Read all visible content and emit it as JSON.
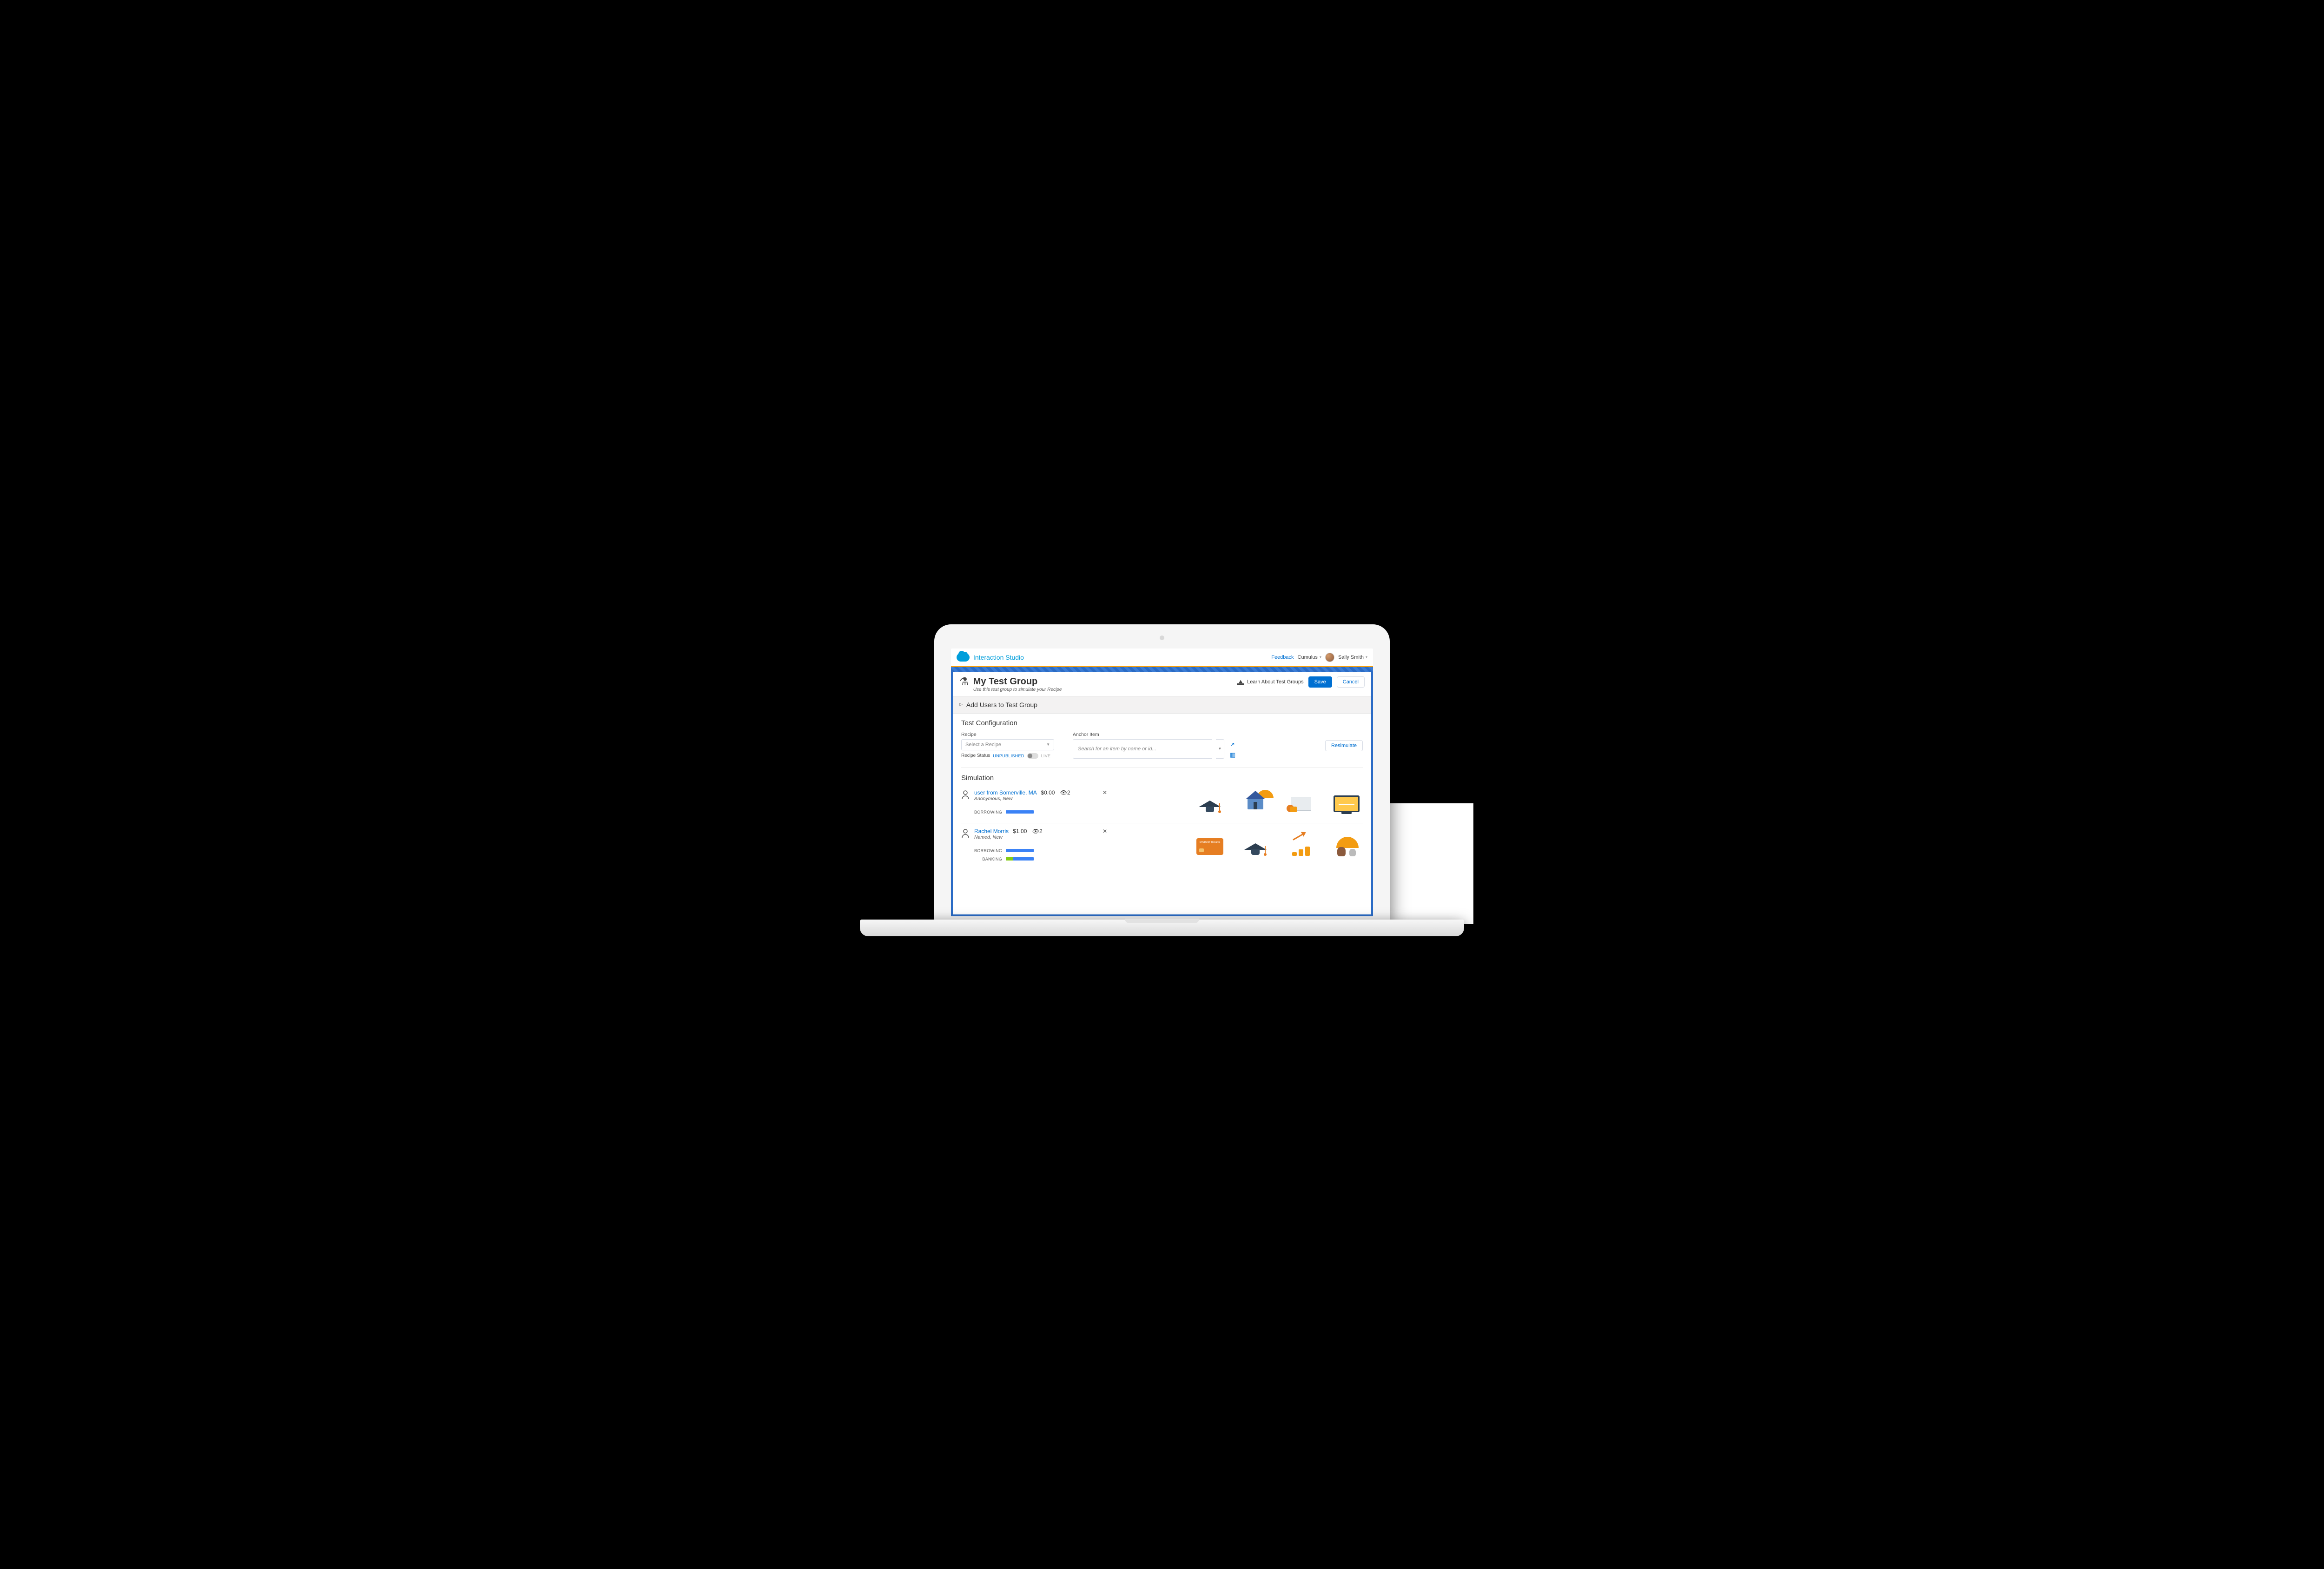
{
  "topbar": {
    "app_title": "Interaction Studio",
    "feedback_label": "Feedback",
    "org_name": "Cumulus",
    "user_name": "Sally Smith"
  },
  "page": {
    "title": "My Test Group",
    "subtitle": "Use this test group to simulate your Recipe",
    "learn_label": "Learn About Test Groups",
    "save_label": "Save",
    "cancel_label": "Cancel"
  },
  "sections": {
    "add_users_title": "Add Users to Test Group"
  },
  "config": {
    "heading": "Test Configuration",
    "recipe_label": "Recipe",
    "recipe_placeholder": "Select a Recipe",
    "recipe_status_label": "Recipe Status",
    "status_unpublished": "UNPUBLISHED",
    "status_live": "LIVE",
    "anchor_label": "Anchor Item",
    "anchor_placeholder": "Search for an item by name or id...",
    "resimulate_label": "Resimulate"
  },
  "simulation": {
    "heading": "Simulation",
    "users": [
      {
        "name": "user from Somerville, MA",
        "type_line": "Anonymous, New",
        "amount": "$0.00",
        "view_count": "2",
        "bars": [
          {
            "label": "BORROWING",
            "class": "bar"
          }
        ],
        "recs": [
          "grad-cap",
          "house-umbrella",
          "paper-stack",
          "monitor"
        ]
      },
      {
        "name": "Rachel Morris",
        "type_line": "Named, New",
        "amount": "$1.00",
        "view_count": "2",
        "bars": [
          {
            "label": "BORROWING",
            "class": "bar"
          },
          {
            "label": "BANKING",
            "class": "bar split"
          }
        ],
        "recs": [
          "card",
          "grad-cap",
          "growth",
          "pets"
        ]
      }
    ]
  }
}
